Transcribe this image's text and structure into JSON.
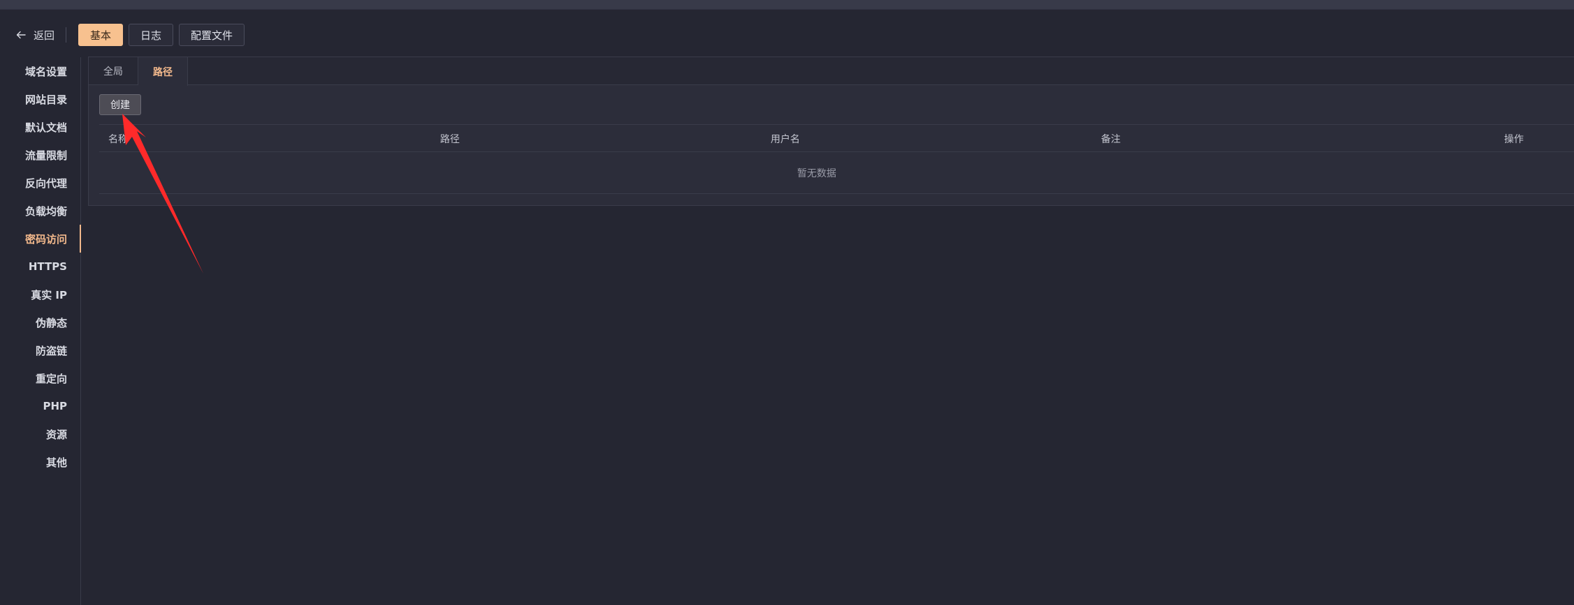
{
  "header": {
    "back_label": "返回",
    "tabs": [
      {
        "label": "基本",
        "active": true
      },
      {
        "label": "日志",
        "active": false
      },
      {
        "label": "配置文件",
        "active": false
      }
    ]
  },
  "sidebar": {
    "items": [
      {
        "label": "域名设置"
      },
      {
        "label": "网站目录"
      },
      {
        "label": "默认文档"
      },
      {
        "label": "流量限制"
      },
      {
        "label": "反向代理"
      },
      {
        "label": "负载均衡"
      },
      {
        "label": "密码访问",
        "active": true
      },
      {
        "label": "HTTPS"
      },
      {
        "label": "真实 IP"
      },
      {
        "label": "伪静态"
      },
      {
        "label": "防盗链"
      },
      {
        "label": "重定向"
      },
      {
        "label": "PHP"
      },
      {
        "label": "资源"
      },
      {
        "label": "其他"
      }
    ]
  },
  "panel": {
    "sub_tabs": [
      {
        "label": "全局",
        "active": false
      },
      {
        "label": "路径",
        "active": true
      }
    ],
    "create_label": "创建",
    "table": {
      "columns": [
        "名称",
        "路径",
        "用户名",
        "备注",
        "操作"
      ],
      "empty_text": "暂无数据"
    }
  },
  "colors": {
    "accent": "#f7c18f",
    "background": "#252632",
    "annotation_arrow": "#ff2a2a"
  }
}
